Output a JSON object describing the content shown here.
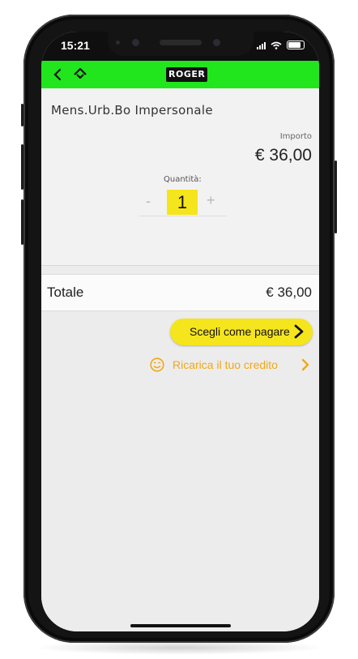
{
  "status_bar": {
    "time": "15:21",
    "icons": [
      "signal-icon",
      "wifi-icon",
      "battery-icon"
    ]
  },
  "app_bar": {
    "back_icon": "chevron-left-icon",
    "home_icon": "home-icon",
    "logo_text": "ROGER",
    "background_color": "#22e61d"
  },
  "product": {
    "name": "Mens.Urb.Bo Impersonale",
    "importo_label": "Importo",
    "importo_value": "€ 36,00",
    "quantity_label": "Quantità:",
    "quantity_minus": "-",
    "quantity_value": "1",
    "quantity_plus": "+"
  },
  "total": {
    "label": "Totale",
    "value": "€ 36,00"
  },
  "actions": {
    "pay_label": "Scegli come pagare",
    "pay_color": "#f5e51c",
    "recharge_label": "Ricarica il tuo credito",
    "recharge_color": "#f0a818",
    "recharge_icon": "smile-icon"
  }
}
